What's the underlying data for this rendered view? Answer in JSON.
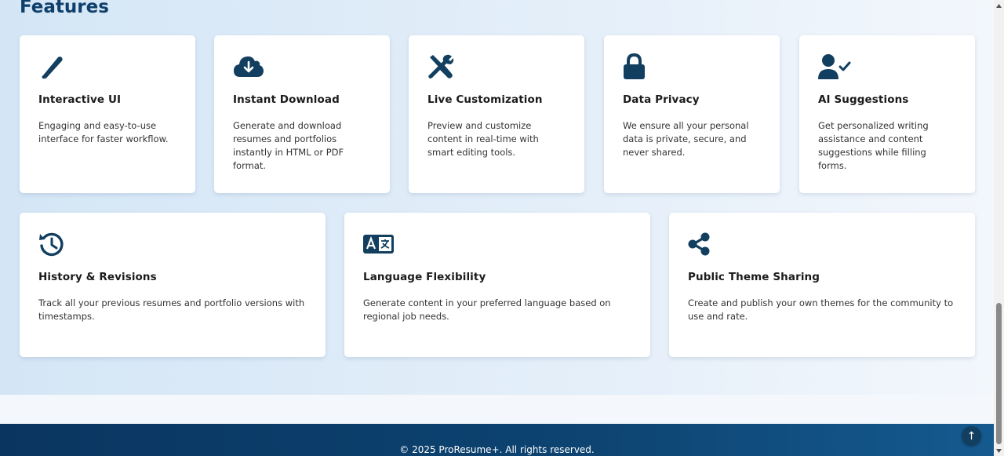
{
  "section": {
    "title": "Features"
  },
  "features": [
    {
      "icon": "pen-icon",
      "title": "Interactive UI",
      "description": "Engaging and easy-to-use interface for faster workflow."
    },
    {
      "icon": "cloud-download-icon",
      "title": "Instant Download",
      "description": "Generate and download resumes and portfolios instantly in HTML or PDF format."
    },
    {
      "icon": "tools-icon",
      "title": "Live Customization",
      "description": "Preview and customize content in real-time with smart editing tools."
    },
    {
      "icon": "lock-icon",
      "title": "Data Privacy",
      "description": "We ensure all your personal data is private, secure, and never shared."
    },
    {
      "icon": "user-check-icon",
      "title": "AI Suggestions",
      "description": "Get personalized writing assistance and content suggestions while filling forms."
    },
    {
      "icon": "history-icon",
      "title": "History & Revisions",
      "description": "Track all your previous resumes and portfolio versions with timestamps."
    },
    {
      "icon": "language-icon",
      "title": "Language Flexibility",
      "description": "Generate content in your preferred language based on regional job needs."
    },
    {
      "icon": "share-icon",
      "title": "Public Theme Sharing",
      "description": "Create and publish your own themes for the community to use and rate."
    }
  ],
  "footer": {
    "copyright": "© 2025 ProResume+. All rights reserved."
  },
  "back_to_top": {
    "icon": "arrow-up-icon",
    "glyph": "↑"
  },
  "colors": {
    "brand_dark": "#0e3f6a",
    "icon": "#123e5f"
  }
}
